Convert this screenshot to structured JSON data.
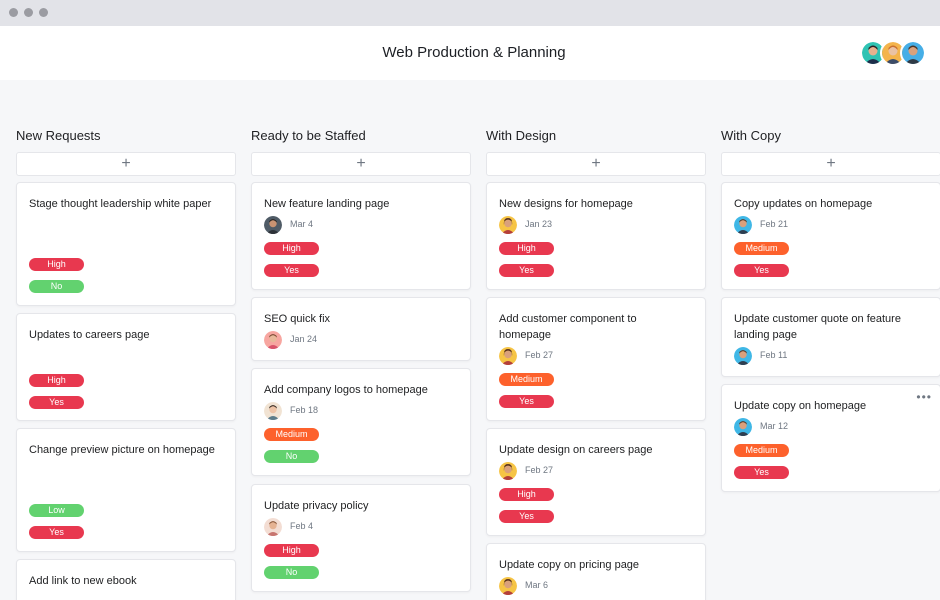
{
  "window": {
    "title": "Web Production & Planning"
  },
  "columns": [
    {
      "title": "New Requests",
      "add_label": "+",
      "cards": [
        {
          "title": "Stage thought leadership white paper",
          "tags": [
            "High",
            "No"
          ]
        },
        {
          "title": "Updates to careers page",
          "tags": [
            "High",
            "Yes"
          ]
        },
        {
          "title": "Change preview picture on homepage",
          "tags": [
            "Low",
            "Yes"
          ]
        },
        {
          "title": "Add link to new ebook"
        }
      ]
    },
    {
      "title": "Ready to be Staffed",
      "add_label": "+",
      "cards": [
        {
          "title": "New feature landing page",
          "due": "Mar 4",
          "tags": [
            "High",
            "Yes"
          ]
        },
        {
          "title": "SEO quick fix",
          "due": "Jan 24"
        },
        {
          "title": "Add company logos to homepage",
          "due": "Feb 18",
          "tags": [
            "Medium",
            "No"
          ]
        },
        {
          "title": "Update privacy policy",
          "due": "Feb 4",
          "tags": [
            "High",
            "No"
          ]
        }
      ]
    },
    {
      "title": "With Design",
      "add_label": "+",
      "cards": [
        {
          "title": "New designs for homepage",
          "due": "Jan 23",
          "tags": [
            "High",
            "Yes"
          ]
        },
        {
          "title": "Add customer component to homepage",
          "due": "Feb 27",
          "tags": [
            "Medium",
            "Yes"
          ]
        },
        {
          "title": "Update design on careers page",
          "due": "Feb 27",
          "tags": [
            "High",
            "Yes"
          ]
        },
        {
          "title": "Update copy on pricing page",
          "due": "Mar 6"
        }
      ]
    },
    {
      "title": "With Copy",
      "add_label": "+",
      "cards": [
        {
          "title": "Copy updates on homepage",
          "due": "Feb 21",
          "tags": [
            "Medium",
            "Yes"
          ]
        },
        {
          "title": "Update customer quote on feature landing page",
          "due": "Feb 11"
        },
        {
          "title": "Update copy on homepage",
          "due": "Mar 12",
          "tags": [
            "Medium",
            "Yes"
          ],
          "more_icon": "more-horizontal-icon"
        }
      ]
    }
  ],
  "colors": {
    "high": "#e8384f",
    "medium": "#fd612c",
    "low_no": "#62d26f",
    "yes": "#e8384f"
  },
  "icons": {
    "add": "plus-icon",
    "avatar": "avatar-icon",
    "more": "more-horizontal-icon"
  }
}
